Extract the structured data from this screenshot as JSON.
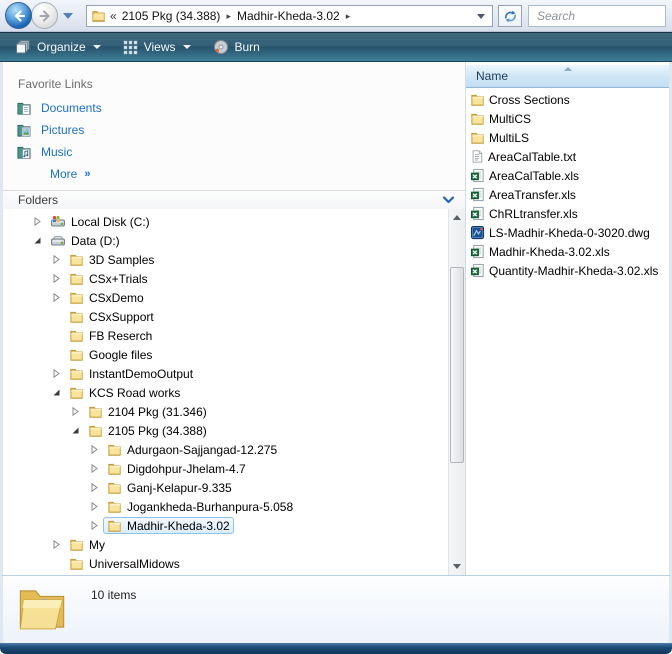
{
  "colors": {
    "link_blue": "#1a70c8",
    "toolbar_teal_bottom": "#3f7e97",
    "header_blue": "#cfe6f7",
    "selection_border": "#90c2e9",
    "frame_navy": "#123758"
  },
  "navbar": {
    "breadcrumb": {
      "collapsed_symbol": "«",
      "items": [
        "2105 Pkg (34.388)",
        "Madhir-Kheda-3.02"
      ],
      "separator": "▸"
    },
    "search": {
      "placeholder": "Search"
    }
  },
  "toolbar": {
    "items": [
      {
        "label": "Organize",
        "icon": "organize",
        "has_dropdown": true
      },
      {
        "label": "Views",
        "icon": "views",
        "has_dropdown": true
      },
      {
        "label": "Burn",
        "icon": "burn",
        "has_dropdown": false
      }
    ]
  },
  "sidebar": {
    "favorites_title": "Favorite Links",
    "favorites": [
      {
        "label": "Documents",
        "icon": "documents"
      },
      {
        "label": "Pictures",
        "icon": "pictures"
      },
      {
        "label": "Music",
        "icon": "music"
      }
    ],
    "more_label": "More",
    "more_symbol": "»",
    "folders_title": "Folders",
    "tree": [
      {
        "label": "Local Disk (C:)",
        "depth": 0,
        "icon": "drive-os",
        "expander": "collapsed",
        "selected": false
      },
      {
        "label": "Data (D:)",
        "depth": 0,
        "icon": "drive",
        "expander": "expanded",
        "selected": false
      },
      {
        "label": "3D Samples",
        "depth": 1,
        "icon": "folder",
        "expander": "collapsed",
        "selected": false
      },
      {
        "label": "CSx+Trials",
        "depth": 1,
        "icon": "folder",
        "expander": "collapsed",
        "selected": false
      },
      {
        "label": "CSxDemo",
        "depth": 1,
        "icon": "folder",
        "expander": "collapsed",
        "selected": false
      },
      {
        "label": "CSxSupport",
        "depth": 1,
        "icon": "folder",
        "expander": "none",
        "selected": false
      },
      {
        "label": "FB Reserch",
        "depth": 1,
        "icon": "folder",
        "expander": "none",
        "selected": false
      },
      {
        "label": "Google files",
        "depth": 1,
        "icon": "folder",
        "expander": "none",
        "selected": false
      },
      {
        "label": "InstantDemoOutput",
        "depth": 1,
        "icon": "folder",
        "expander": "collapsed",
        "selected": false
      },
      {
        "label": "KCS Road works",
        "depth": 1,
        "icon": "folder",
        "expander": "expanded",
        "selected": false
      },
      {
        "label": "2104 Pkg (31.346)",
        "depth": 2,
        "icon": "folder",
        "expander": "collapsed",
        "selected": false
      },
      {
        "label": "2105 Pkg (34.388)",
        "depth": 2,
        "icon": "folder",
        "expander": "expanded",
        "selected": false
      },
      {
        "label": "Adurgaon-Sajjangad-12.275",
        "depth": 3,
        "icon": "folder",
        "expander": "collapsed",
        "selected": false
      },
      {
        "label": "Digdohpur-Jhelam-4.7",
        "depth": 3,
        "icon": "folder",
        "expander": "collapsed",
        "selected": false
      },
      {
        "label": "Ganj-Kelapur-9.335",
        "depth": 3,
        "icon": "folder",
        "expander": "collapsed",
        "selected": false
      },
      {
        "label": "Jogankheda-Burhanpura-5.058",
        "depth": 3,
        "icon": "folder",
        "expander": "collapsed",
        "selected": false
      },
      {
        "label": "Madhir-Kheda-3.02",
        "depth": 3,
        "icon": "folder",
        "expander": "collapsed",
        "selected": true
      },
      {
        "label": "My",
        "depth": 1,
        "icon": "folder",
        "expander": "collapsed",
        "selected": false
      },
      {
        "label": "UniversalMidows",
        "depth": 1,
        "icon": "folder",
        "expander": "none",
        "selected": false
      }
    ]
  },
  "filelist": {
    "column_header": "Name",
    "items": [
      {
        "name": "Cross Sections",
        "icon": "folder"
      },
      {
        "name": "MultiCS",
        "icon": "folder"
      },
      {
        "name": "MultiLS",
        "icon": "folder"
      },
      {
        "name": "AreaCalTable.txt",
        "icon": "text"
      },
      {
        "name": "AreaCalTable.xls",
        "icon": "excel"
      },
      {
        "name": "AreaTransfer.xls",
        "icon": "excel"
      },
      {
        "name": "ChRLtransfer.xls",
        "icon": "excel"
      },
      {
        "name": "LS-Madhir-Kheda-0-3020.dwg",
        "icon": "dwg"
      },
      {
        "name": "Madhir-Kheda-3.02.xls",
        "icon": "excel"
      },
      {
        "name": "Quantity-Madhir-Kheda-3.02.xls",
        "icon": "excel"
      }
    ]
  },
  "statusbar": {
    "items_count": "10 items"
  }
}
